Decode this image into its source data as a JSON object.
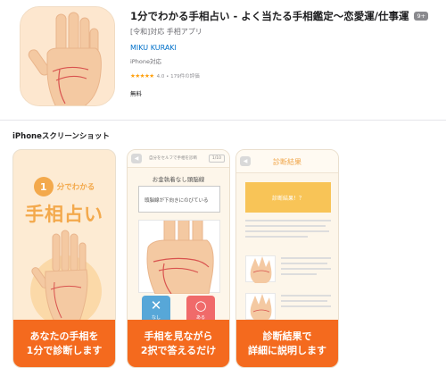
{
  "app": {
    "title": "1分でわかる手相占い - よく当たる手相鑑定～恋愛運/仕事運",
    "age_badge": "9+",
    "subtitle": "[令和]対応 手相アプリ",
    "developer": "MIKU KURAKI",
    "compatibility": "iPhone対応",
    "stars": "★★★★★",
    "rating_text": "4.0 • 179件の評価",
    "price": "無料"
  },
  "screenshots": {
    "section_title": "iPhoneスクリーンショット",
    "shot1": {
      "circle_text": "1",
      "small_text": "分でわかる",
      "big_text": "手相占い",
      "banner": [
        "あなたの手相を",
        "1分で診断します"
      ]
    },
    "shot2": {
      "topbar_text": "自分をセルフで手相を診断",
      "counter": "1/10",
      "question_title": "お金執着なし頭脳線",
      "question_text": "頭脳線が下向きにのびている",
      "no_symbol": "✕",
      "no_label": "なし",
      "yes_symbol": "○",
      "yes_label": "ある",
      "banner": [
        "手相を見ながら",
        "2択で答えるだけ"
      ]
    },
    "shot3": {
      "result_title": "診断結果",
      "result_box": "診断結果！？",
      "banner": [
        "診断結果で",
        "詳細に説明します"
      ]
    }
  },
  "colors": {
    "accent_orange": "#f46a1e",
    "link_blue": "#0070c9",
    "palm_skin": "#f4c9a2"
  }
}
